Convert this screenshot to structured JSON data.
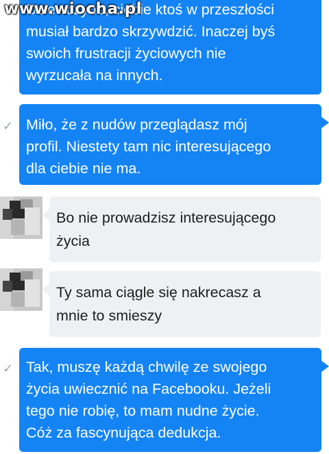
{
  "watermark": "www.wiocha.pl",
  "colors": {
    "outgoing": "#1484f5",
    "incoming": "#eef0f3",
    "check": "#9aa4b0"
  },
  "messages": [
    {
      "direction": "outgoing",
      "status_icon": "check-icon",
      "text": "Dziewczyno, ciebie ktoś w przeszłości\nmusiał bardzo skrzywdzić. Inaczej byś\nswoich frustracji życiowych nie\nwyrzucała na innych."
    },
    {
      "direction": "outgoing",
      "status_icon": "check-icon",
      "text": "Miło, że z nudów przeglądasz mój\nprofil. Niestety tam nic interesującego\ndla ciebie nie ma."
    },
    {
      "direction": "incoming",
      "avatar": "pixelated-avatar",
      "text": "Bo nie prowadzisz interesującego\nżycia"
    },
    {
      "direction": "incoming",
      "avatar": "pixelated-avatar",
      "text": "Ty sama ciągle się nakrecasz a\nmnie to smieszy"
    },
    {
      "direction": "outgoing",
      "status_icon": "check-icon",
      "text": "Tak, muszę każdą chwilę ze swojego\nżycia uwiecznić na Facebooku. Jeżeli\ntego nie robię, to mam nudne życie.\nCóż za fascynująca dedukcja."
    }
  ]
}
